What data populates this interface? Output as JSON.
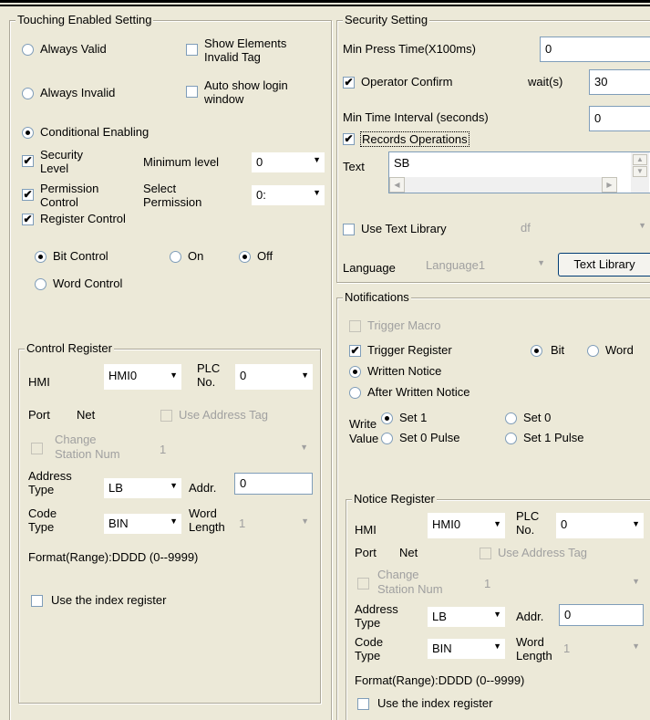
{
  "touching": {
    "legend": "Touching Enabled Setting",
    "always_valid": "Always Valid",
    "show_elements": "Show Elements",
    "invalid_tag": "Invalid Tag",
    "always_invalid": "Always Invalid",
    "auto_show": "Auto show login",
    "window": "window",
    "conditional": "Conditional Enabling",
    "security": "Security",
    "level": "Level",
    "minimum_level": "Minimum level",
    "min_level_value": "0",
    "permission": "Permission",
    "control": "Control",
    "select": "Select",
    "permission2": "Permission",
    "perm_value": "0:",
    "register_control": "Register Control",
    "bit_control": "Bit Control",
    "on": "On",
    "off": "Off",
    "word_control": "Word Control"
  },
  "control_register": {
    "legend": "Control Register",
    "hmi": "HMI",
    "hmi_value": "HMI0",
    "plc": "PLC",
    "no": "No.",
    "plc_value": "0",
    "port": "Port",
    "net": "Net",
    "use_address_tag": "Use Address Tag",
    "change": "Change",
    "station_num": "Station Num",
    "station_value": "1",
    "address": "Address",
    "type": "Type",
    "addr_type_value": "LB",
    "addr": "Addr.",
    "addr_value": "0",
    "code": "Code",
    "code_type": "Type",
    "code_value": "BIN",
    "word": "Word",
    "length": "Length",
    "length_value": "1",
    "format": "Format(Range):DDDD (0--9999)",
    "use_index": "Use the index register"
  },
  "security": {
    "legend": "Security Setting",
    "min_press": "Min Press Time(X100ms)",
    "min_press_value": "0",
    "operator_confirm": "Operator Confirm",
    "wait": "wait(s)",
    "wait_value": "30",
    "min_interval": "Min Time Interval (seconds)",
    "min_interval_value": "0",
    "records": "Records Operations",
    "text": "Text",
    "text_value": "SB",
    "use_text_library": "Use Text Library",
    "library_value": "df",
    "language": "Language",
    "language_value": "Language1",
    "text_library_button": "Text Library"
  },
  "notifications": {
    "legend": "Notifications",
    "trigger_macro": "Trigger Macro",
    "trigger_register": "Trigger Register",
    "bit": "Bit",
    "word": "Word",
    "written_notice": "Written Notice",
    "after_written": "After Written Notice",
    "write": "Write",
    "value": "Value",
    "set1": "Set 1",
    "set0": "Set 0",
    "set0_pulse": "Set 0 Pulse",
    "set1_pulse": "Set 1 Pulse"
  },
  "notice_register": {
    "legend": "Notice Register",
    "hmi": "HMI",
    "hmi_value": "HMI0",
    "plc": "PLC",
    "no": "No.",
    "plc_value": "0",
    "port": "Port",
    "net": "Net",
    "use_address_tag": "Use Address Tag",
    "change": "Change",
    "station_num": "Station Num",
    "station_value": "1",
    "address": "Address",
    "type": "Type",
    "addr_type_value": "LB",
    "addr": "Addr.",
    "addr_value": "0",
    "code": "Code",
    "code_type": "Type",
    "code_value": "BIN",
    "word": "Word",
    "length": "Length",
    "length_value": "1",
    "format": "Format(Range):DDDD (0--9999)",
    "use_index": "Use the index register"
  },
  "icons": {
    "check": "✔",
    "dropdown": "▼"
  }
}
